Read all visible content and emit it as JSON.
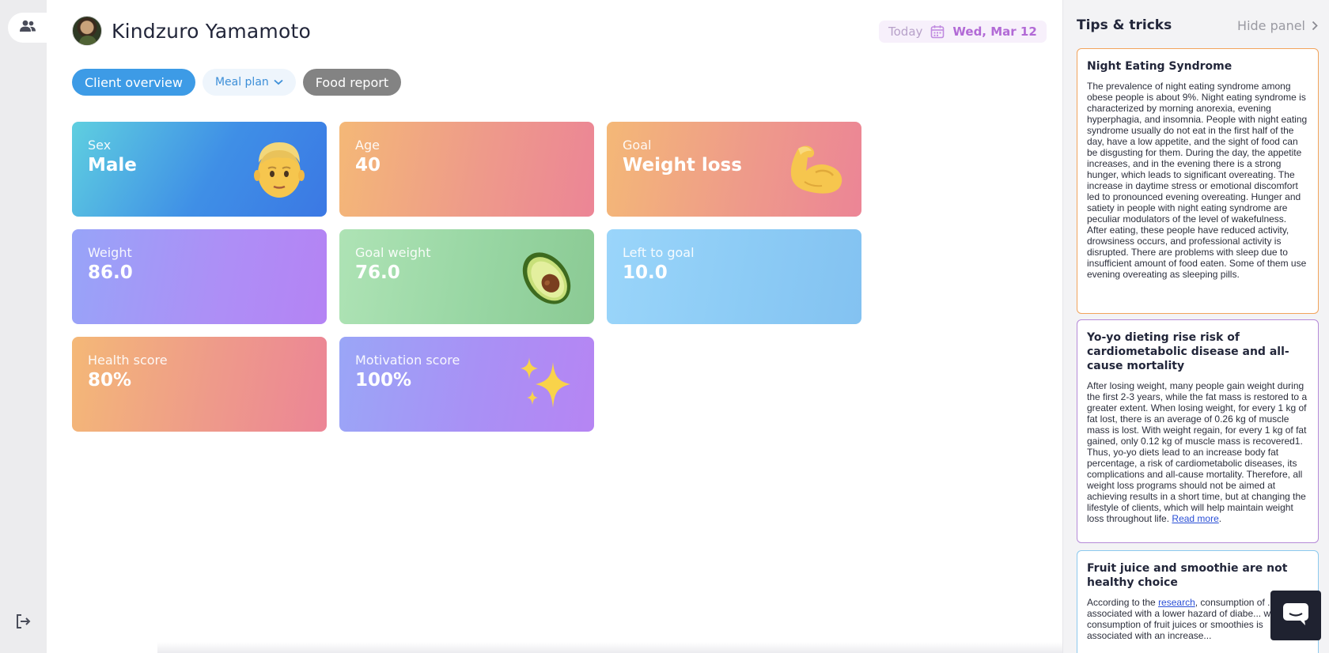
{
  "client": {
    "name": "Kindzuro Yamamoto"
  },
  "date_bar": {
    "today_label": "Today",
    "date": "Wed, Mar 12"
  },
  "tabs": [
    {
      "label": "Client overview"
    },
    {
      "label": "Meal plan"
    },
    {
      "label": "Food report"
    }
  ],
  "stats": {
    "sex": {
      "label": "Sex",
      "value": "Male"
    },
    "age": {
      "label": "Age",
      "value": "40"
    },
    "goal": {
      "label": "Goal",
      "value": "Weight loss"
    },
    "weight": {
      "label": "Weight",
      "value": "86.0"
    },
    "goal_weight": {
      "label": "Goal weight",
      "value": "76.0"
    },
    "left_to_goal": {
      "label": "Left to goal",
      "value": "10.0"
    },
    "health_score": {
      "label": "Health score",
      "value": "80%"
    },
    "motivation_score": {
      "label": "Motivation score",
      "value": "100%"
    }
  },
  "panel": {
    "title": "Tips & tricks",
    "hide_label": "Hide panel",
    "tips": [
      {
        "title": "Night Eating Syndrome",
        "body": "The prevalence of night eating syndrome among obese people is about 9%. Night eating syndrome is characterized by morning anorexia, evening hyperphagia, and insomnia. People with night eating syndrome usually do not eat in the first half of the day, have a low appetite, and the sight of food can be disgusting for them. During the day, the appetite increases, and in the evening there is a strong hunger, which leads to significant overeating. The increase in daytime stress or emotional discomfort led to pronounced evening overeating. Hunger and satiety in people with night eating syndrome are peculiar modulators of the level of wakefulness. After eating, these people have reduced activity, drowsiness occurs, and professional activity is disrupted. There are problems with sleep due to insufficient amount of food eaten. Some of them use evening overeating as sleeping pills."
      },
      {
        "title": "Yo-yo dieting rise risk of cardiometabolic disease and all-cause mortality",
        "body": "After losing weight, many people gain weight during the first 2-3 years, while the fat mass is restored to a greater extent. When losing weight, for every 1 kg of fat lost, there is an average of 0.26 kg of muscle mass is lost. With weight regain, for every 1 kg of fat gained, only 0.12 kg of muscle mass is recovered1. Thus, yo-yo diets lead to an increase body fat percentage, a risk of cardiometabolic diseases, its complications and all-cause mortality. Therefore, all weight loss programs should not be aimed at achieving results in a short time, but at changing the lifestyle of clients, which will help maintain weight loss throughout life.",
        "link_label": "Read more"
      },
      {
        "title": "Fruit juice and smoothie are not healthy choice",
        "body_prefix": "According to the",
        "link_label": "research",
        "body_suffix": ", consumption of ... is associated with a lower hazard of diabe... whereas consumption of fruit juices or smoothies is associated with an increase..."
      }
    ]
  },
  "icons": {
    "rail_top": "people-icon",
    "rail_bottom": "logout-icon",
    "calendar": "calendar-icon",
    "chat": "chat-icon"
  },
  "colors": {
    "primary_blue": "#3d9be6",
    "accent_purple": "#b26ad6",
    "tip1_border": "#f2a45c",
    "tip2_border": "#b58ad8",
    "tip3_border": "#8cc9ee"
  }
}
